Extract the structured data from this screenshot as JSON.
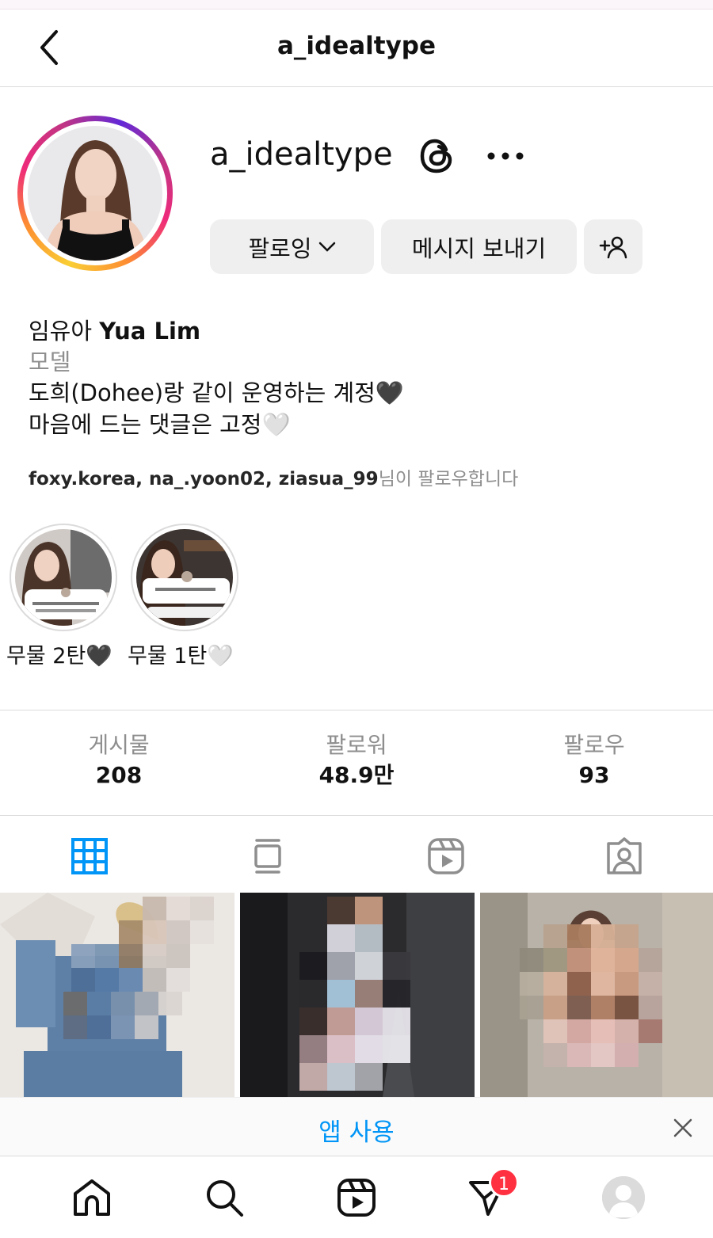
{
  "header": {
    "title": "a_idealtype"
  },
  "profile": {
    "username": "a_idealtype",
    "follow_button": "팔로잉",
    "message_button": "메시지 보내기",
    "name_korean": "임유아",
    "name_english": "Yua Lim",
    "category": "모델",
    "bio_line1": "도희(Dohee)랑 같이 운영하는 계정🖤",
    "bio_line2": "마음에 드는 댓글은 고정🤍",
    "followed_by_users": "foxy.korea, na_.yoon02, ziasua_99",
    "followed_by_suffix": "님이 팔로우합니다"
  },
  "highlights": [
    {
      "label": "무물 2탄🖤"
    },
    {
      "label": "무물 1탄🤍"
    }
  ],
  "stats": [
    {
      "label": "게시물",
      "value": "208"
    },
    {
      "label": "팔로워",
      "value": "48.9만"
    },
    {
      "label": "팔로우",
      "value": "93"
    }
  ],
  "tabs": [
    {
      "icon": "grid-icon",
      "active": true
    },
    {
      "icon": "feed-icon",
      "active": false
    },
    {
      "icon": "reels-icon",
      "active": false
    },
    {
      "icon": "tagged-icon",
      "active": false
    }
  ],
  "app_banner": {
    "label": "앱 사용"
  },
  "bottom_nav": {
    "dm_badge": "1"
  },
  "colors": {
    "accent": "#0095f6",
    "badge": "#ff3040",
    "button_bg": "#efefef",
    "muted_text": "#8e8e8e"
  }
}
